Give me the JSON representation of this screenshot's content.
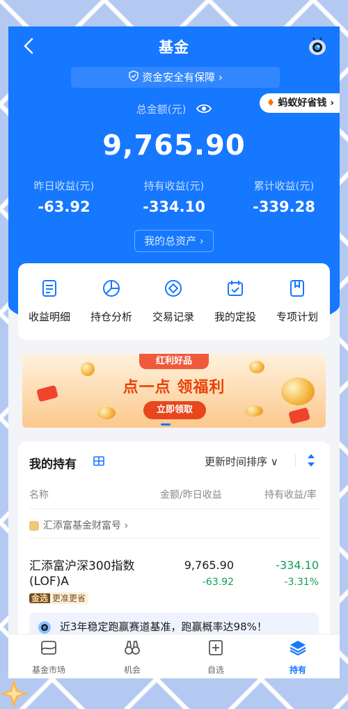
{
  "nav": {
    "title": "基金"
  },
  "safety_bar": {
    "text": "资金安全有保障 ›"
  },
  "ant_badge": {
    "label": "蚂蚁好省钱 ›"
  },
  "summary": {
    "total_label": "总金额(元)",
    "total_value": "9,765.90",
    "stats": [
      {
        "label": "昨日收益(元)",
        "value": "-63.92"
      },
      {
        "label": "持有收益(元)",
        "value": "-334.10"
      },
      {
        "label": "累计收益(元)",
        "value": "-339.28"
      }
    ],
    "assets_button": "我的总资产 ›"
  },
  "quick_actions": [
    {
      "label": "收益明细",
      "icon": "document-icon"
    },
    {
      "label": "持仓分析",
      "icon": "pie-chart-icon"
    },
    {
      "label": "交易记录",
      "icon": "diamond-circle-icon"
    },
    {
      "label": "我的定投",
      "icon": "calendar-check-icon"
    },
    {
      "label": "专项计划",
      "icon": "bookmark-icon"
    }
  ],
  "banner": {
    "tag": "红利好品",
    "headline": "点一点 领福利",
    "cta": "立即领取"
  },
  "holdings": {
    "title": "我的持有",
    "sort_label": "更新时间排序 ∨",
    "columns": [
      "名称",
      "金额/昨日收益",
      "持有收益/率"
    ],
    "company": "汇添富基金财富号 ›",
    "fund": {
      "name": "汇添富沪深300指数(LOF)A",
      "tag_gold": "金选",
      "tag_text": "更准更省",
      "amount": "9,765.90",
      "yesterday": "-63.92",
      "hold": "-334.10",
      "hold_rate": "-3.31%"
    },
    "tip": "近3年稳定跑赢赛道基准，跑赢概率达98%！"
  },
  "tabbar": [
    {
      "label": "基金市场",
      "icon": "market-icon",
      "active": false
    },
    {
      "label": "机会",
      "icon": "binoculars-icon",
      "active": false
    },
    {
      "label": "自选",
      "icon": "plus-box-icon",
      "active": false
    },
    {
      "label": "持有",
      "icon": "layers-icon",
      "active": true
    }
  ],
  "colors": {
    "brand_blue": "#1677ff",
    "loss_green": "#0f9d58",
    "banner_orange": "#e8461c"
  }
}
